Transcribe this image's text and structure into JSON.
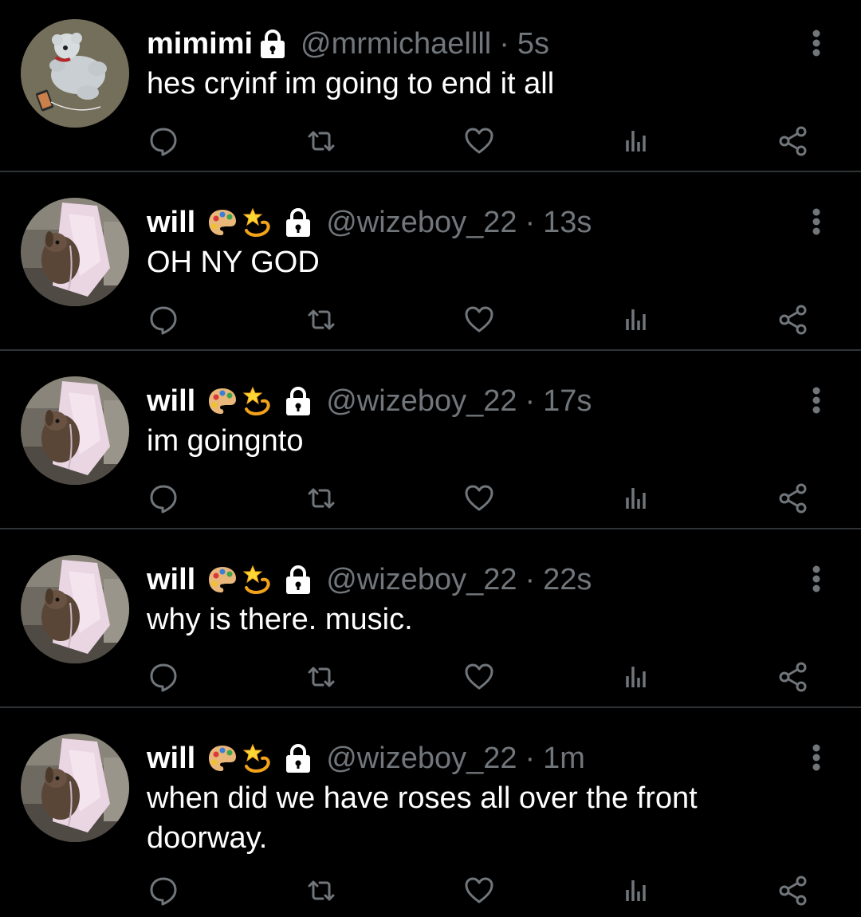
{
  "tweets": [
    {
      "name": "mimimi",
      "handle": "@mrmichaellll",
      "separator": "·",
      "time": "5s",
      "text": "hes cryinf im going to end it all",
      "avatar": "avatar-plush-bear",
      "emojis": []
    },
    {
      "name": "will",
      "handle": "@wizeboy_22",
      "separator": "·",
      "time": "13s",
      "text": "OH NY GOD",
      "avatar": "avatar-bunny",
      "emojis": [
        "artist-palette",
        "dizzy"
      ]
    },
    {
      "name": "will",
      "handle": "@wizeboy_22",
      "separator": "·",
      "time": "17s",
      "text": "im goingnto",
      "avatar": "avatar-bunny",
      "emojis": [
        "artist-palette",
        "dizzy"
      ]
    },
    {
      "name": "will",
      "handle": "@wizeboy_22",
      "separator": "·",
      "time": "22s",
      "text": "why is there. music.",
      "avatar": "avatar-bunny",
      "emojis": [
        "artist-palette",
        "dizzy"
      ]
    },
    {
      "name": "will",
      "handle": "@wizeboy_22",
      "separator": "·",
      "time": "1m",
      "text": "when did we have roses all over the front doorway.",
      "avatar": "avatar-bunny",
      "emojis": [
        "artist-palette",
        "dizzy"
      ]
    }
  ],
  "icons": {
    "actions": [
      "reply-icon",
      "retweet-icon",
      "like-icon",
      "analytics-icon",
      "share-icon"
    ],
    "protected": "lock-icon",
    "more": "more-options-icon"
  },
  "colors": {
    "background": "#000000",
    "text": "#ffffff",
    "muted": "#71767b",
    "divider": "#2f3336"
  }
}
